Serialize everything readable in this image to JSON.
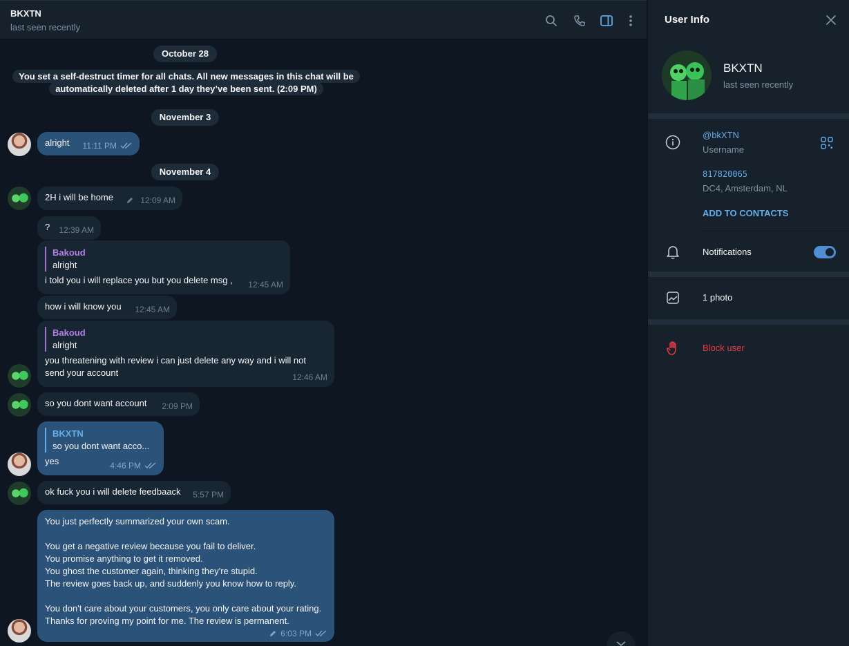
{
  "header": {
    "title": "BKXTN",
    "status": "last seen recently",
    "icons": [
      "search-icon",
      "phone-icon",
      "sidebar-toggle-icon",
      "more-vertical-icon"
    ]
  },
  "messages": {
    "date_oct28": "October 28",
    "service_timer": "You set a self-destruct timer for all chats. All new messages in this chat will be automatically deleted after 1 day they’ve been sent. (2:09 PM)",
    "date_nov3": "November 3",
    "m1": {
      "text": "alright",
      "time": "11:11 PM"
    },
    "date_nov4": "November 4",
    "m2": {
      "text": "2H i will be home",
      "time": "12:09 AM"
    },
    "m3": {
      "text": "?",
      "time": "12:39 AM"
    },
    "m4": {
      "reply_name": "Bakoud",
      "reply_text": "alright",
      "text": "i told you i will replace you but you delete msg ,",
      "time": "12:45 AM"
    },
    "m5": {
      "text": "how i will know you",
      "time": "12:45 AM"
    },
    "m6": {
      "reply_name": "Bakoud",
      "reply_text": "alright",
      "text": "you threatening with review i can just delete any way and i will not send your account",
      "time": "12:46 AM"
    },
    "m7": {
      "text": "so you dont want account",
      "time": "2:09 PM"
    },
    "m8": {
      "reply_name": "BKXTN",
      "reply_text": "so you dont want acco...",
      "text": "yes",
      "time": "4:46 PM"
    },
    "m9": {
      "text": "ok fuck you i will delete feedbaack",
      "time": "5:57 PM"
    },
    "m10": {
      "p1": "You just perfectly summarized your own scam.",
      "p2a": "You get a negative review because you fail to deliver.",
      "p2b": "You promise anything to get it removed.",
      "p2c": "You ghost the customer again, thinking they're stupid.",
      "p2d": "The review goes back up, and suddenly you know how to reply.",
      "p3": "You don't care about your customers, you only care about your rating. Thanks for proving my point for me. The review is permanent.",
      "time": "6:03 PM"
    }
  },
  "panel": {
    "title": "User Info",
    "name": "BKXTN",
    "status": "last seen recently",
    "username": "@bkXTN",
    "username_label": "Username",
    "id": "817820065",
    "dc": "DC4, Amsterdam, NL",
    "add_contacts": "ADD TO CONTACTS",
    "notifications": "Notifications",
    "notifications_on": true,
    "photos": "1 photo",
    "block": "Block user"
  },
  "colors": {
    "bg": "#0e1621",
    "panel": "#17212b",
    "incoming": "#182533",
    "outgoing": "#2b5278",
    "accent": "#63aee8",
    "danger": "#ec3942"
  }
}
